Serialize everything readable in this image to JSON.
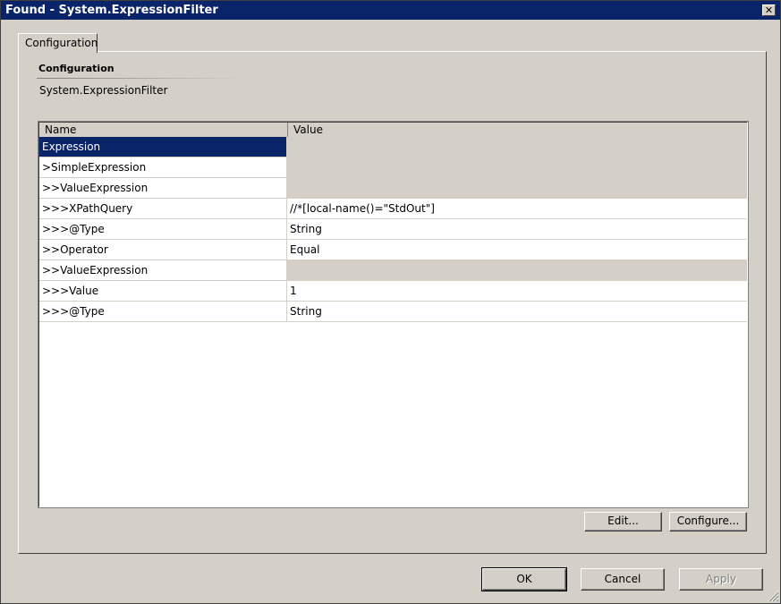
{
  "window": {
    "title": "Found - System.ExpressionFilter",
    "close_icon": "close-icon"
  },
  "tabs": [
    {
      "label": "Configuration",
      "selected": true
    }
  ],
  "section": {
    "title": "Configuration",
    "subtitle": "System.ExpressionFilter"
  },
  "grid": {
    "columns": [
      "Name",
      "Value"
    ],
    "rows": [
      {
        "name": "Expression",
        "value": "",
        "selected": true,
        "value_editable": false
      },
      {
        "name": ">SimpleExpression",
        "value": "",
        "value_editable": false
      },
      {
        "name": ">>ValueExpression",
        "value": "",
        "value_editable": false
      },
      {
        "name": ">>>XPathQuery",
        "value": "//*[local-name()=\"StdOut\"]",
        "value_editable": true
      },
      {
        "name": ">>>@Type",
        "value": "String",
        "value_editable": true
      },
      {
        "name": ">>Operator",
        "value": "Equal",
        "value_editable": true
      },
      {
        "name": ">>ValueExpression",
        "value": "",
        "value_editable": false
      },
      {
        "name": ">>>Value",
        "value": "1",
        "value_editable": true
      },
      {
        "name": ">>>@Type",
        "value": "String",
        "value_editable": true
      }
    ]
  },
  "buttons": {
    "edit": "Edit...",
    "configure": "Configure...",
    "ok": "OK",
    "cancel": "Cancel",
    "apply": "Apply"
  },
  "colors": {
    "titlebar": "#0a246a",
    "face": "#d4d0c8",
    "selection": "#0a246a"
  }
}
